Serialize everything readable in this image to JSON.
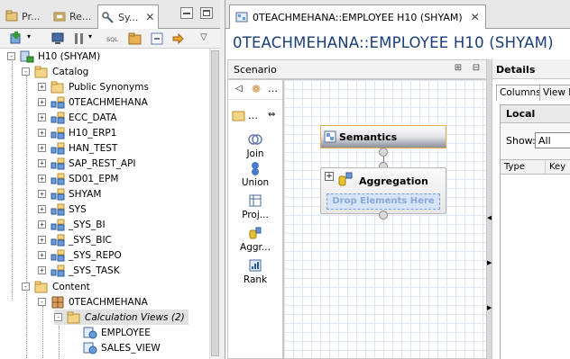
{
  "left_panel": {
    "tabs": [
      {
        "label": "Pr..."
      },
      {
        "label": "Re..."
      },
      {
        "label": "Sy..."
      }
    ],
    "tree": [
      {
        "label": "H10 (SHYAM)",
        "level": 0,
        "type": "system",
        "expander": "-"
      },
      {
        "label": "Catalog",
        "level": 1,
        "type": "folder",
        "expander": "-"
      },
      {
        "label": "Public Synonyms",
        "level": 2,
        "type": "folder",
        "expander": "+"
      },
      {
        "label": "0TEACHMEHANA",
        "level": 2,
        "type": "schema",
        "expander": "+"
      },
      {
        "label": "ECC_DATA",
        "level": 2,
        "type": "schema",
        "expander": "+"
      },
      {
        "label": "H10_ERP1",
        "level": 2,
        "type": "schema",
        "expander": "+"
      },
      {
        "label": "HAN_TEST",
        "level": 2,
        "type": "schema",
        "expander": "+"
      },
      {
        "label": "SAP_REST_API",
        "level": 2,
        "type": "schema",
        "expander": "+"
      },
      {
        "label": "SD01_EPM",
        "level": 2,
        "type": "schema",
        "expander": "+"
      },
      {
        "label": "SHYAM",
        "level": 2,
        "type": "schema",
        "expander": "+"
      },
      {
        "label": "SYS",
        "level": 2,
        "type": "schema",
        "expander": "+"
      },
      {
        "label": "_SYS_BI",
        "level": 2,
        "type": "schema",
        "expander": "+"
      },
      {
        "label": "_SYS_BIC",
        "level": 2,
        "type": "schema",
        "expander": "+"
      },
      {
        "label": "_SYS_REPO",
        "level": 2,
        "type": "schema",
        "expander": "+"
      },
      {
        "label": "_SYS_TASK",
        "level": 2,
        "type": "schema",
        "expander": "+"
      },
      {
        "label": "Content",
        "level": 1,
        "type": "folder",
        "expander": "-"
      },
      {
        "label": "0TEACHMEHANA",
        "level": 2,
        "type": "package",
        "expander": "-"
      },
      {
        "label": "Calculation Views (2)",
        "level": 3,
        "type": "folder",
        "expander": "-",
        "selected": true
      },
      {
        "label": "EMPLOYEE",
        "level": 4,
        "type": "view",
        "expander": ""
      },
      {
        "label": "SALES_VIEW",
        "level": 4,
        "type": "view",
        "expander": ""
      }
    ]
  },
  "editor": {
    "tab_label": "0TEACHMEHANA::EMPLOYEE H10 (SHYAM)",
    "title": "0TEACHMEHANA::EMPLOYEE H10 (SHYAM)",
    "scenario_label": "Scenario",
    "palette": [
      {
        "label": "Join",
        "icon": "join-icon"
      },
      {
        "label": "Union",
        "icon": "union-icon"
      },
      {
        "label": "Proj...",
        "icon": "projection-icon"
      },
      {
        "label": "Aggr...",
        "icon": "aggregation-icon"
      },
      {
        "label": "Rank",
        "icon": "rank-icon"
      }
    ],
    "nodes": {
      "semantics": "Semantics",
      "aggregation": "Aggregation",
      "drop_hint": "Drop Elements Here"
    }
  },
  "details": {
    "title": "Details",
    "tabs": [
      "Columns",
      "View P"
    ],
    "local_label": "Local",
    "show_label": "Show:",
    "show_value": "All",
    "columns": [
      "Type",
      "Key"
    ]
  },
  "colors": {
    "title_blue": "#1a3e7a",
    "selection": "#e2e2e2",
    "drop_zone": "#d6e4f8"
  }
}
